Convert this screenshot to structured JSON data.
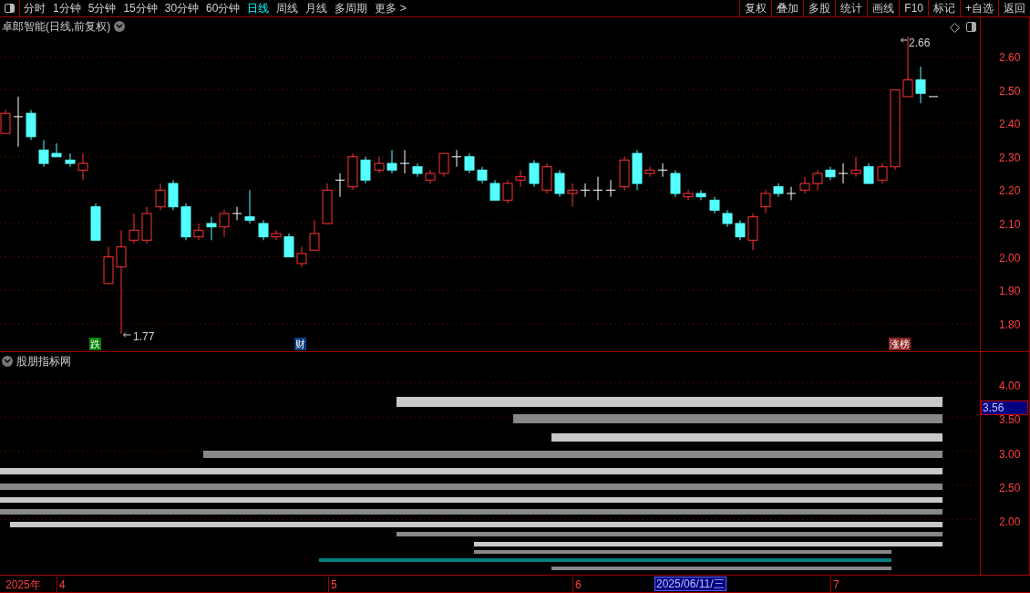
{
  "toolbar": {
    "periods": [
      {
        "label": "分时",
        "selected": false
      },
      {
        "label": "1分钟",
        "selected": false
      },
      {
        "label": "5分钟",
        "selected": false
      },
      {
        "label": "15分钟",
        "selected": false
      },
      {
        "label": "30分钟",
        "selected": false
      },
      {
        "label": "60分钟",
        "selected": false
      },
      {
        "label": "日线",
        "selected": true
      },
      {
        "label": "周线",
        "selected": false
      },
      {
        "label": "月线",
        "selected": false
      },
      {
        "label": "多周期",
        "selected": false
      },
      {
        "label": "更多 >",
        "selected": false
      }
    ],
    "buttons": [
      "复权",
      "叠加",
      "多股",
      "统计",
      "画线",
      "F10",
      "标记",
      "+自选",
      "返回"
    ]
  },
  "main_chart": {
    "title": "卓郎智能(日线,前复权)",
    "yticks": [
      "2.60",
      "2.50",
      "2.40",
      "2.30",
      "2.20",
      "2.10",
      "2.00",
      "1.90",
      "1.80"
    ],
    "high_label": "2.66",
    "low_label": "1.77",
    "markers": [
      {
        "label": "跌",
        "color": "#008000"
      },
      {
        "label": "财",
        "color": "#0a3a7a"
      },
      {
        "label": "涨榜",
        "color": "#8a2020"
      }
    ]
  },
  "indicator": {
    "title": "股朋指标网",
    "yticks": [
      "4.00",
      "3.50",
      "3.00",
      "2.50",
      "2.00"
    ],
    "current_value": "3.56"
  },
  "date_axis": {
    "year": "2025年",
    "months": [
      "4",
      "5",
      "6",
      "7"
    ],
    "cursor_date": "2025/06/11/三"
  }
}
